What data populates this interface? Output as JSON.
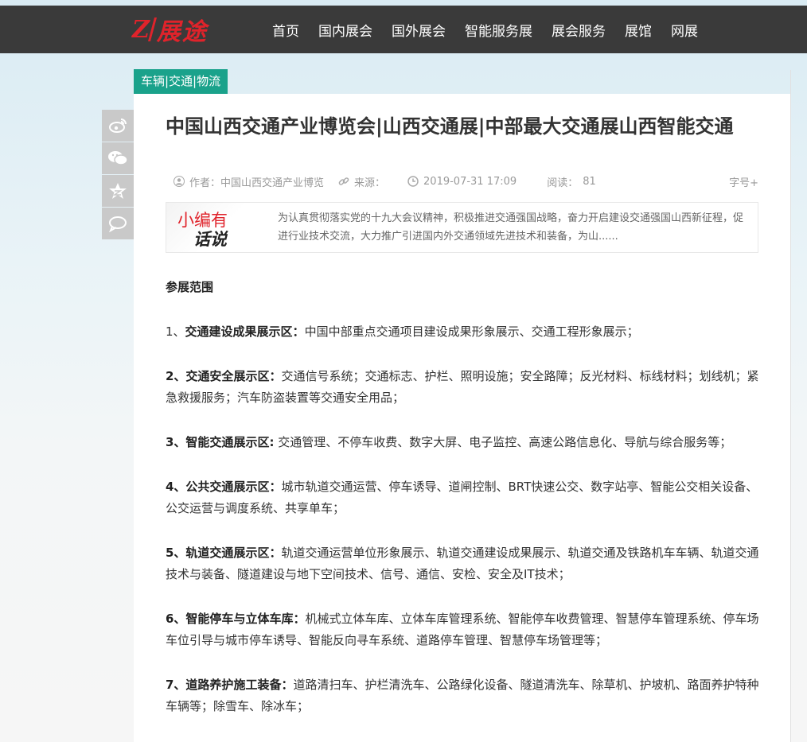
{
  "header": {
    "logo_mark": "Z",
    "logo_name": "展途",
    "nav": [
      "首页",
      "国内展会",
      "国外展会",
      "智能服务展",
      "展会服务",
      "展馆",
      "网展"
    ]
  },
  "category": "车辆|交通|物流",
  "share": [
    "weibo-icon",
    "wechat-icon",
    "qzone-icon",
    "comment-icon"
  ],
  "article": {
    "title": "中国山西交通产业博览会|山西交通展|中部最大交通展山西智能交通",
    "meta": {
      "author_label": "作者：中国山西交通产业博览",
      "source_label": "来源：",
      "datetime": "2019-07-31 17:09",
      "views_label": "阅读：",
      "views": "81",
      "font_size": "字号+"
    },
    "summary": {
      "tag_line1": "小编有",
      "tag_line2": "话说",
      "text": "为认真贯彻落实党的十九大会议精神，积极推进交通强国战略，奋力开启建设交通强国山西新征程，促进行业技术交流，大力推广引进国内外交通领域先进技术和装备，为山......"
    },
    "section_title": "参展范围",
    "items": [
      {
        "heading": "1、交通建设成果展示区：",
        "heading_plain": "1、",
        "heading_bold": "交通建设成果展示区：",
        "text": "中国中部重点交通项目建设成果形象展示、交通工程形象展示；"
      },
      {
        "heading_plain": "",
        "heading_bold": "2、交通安全展示区：",
        "text": "交通信号系统；交通标志、护栏、照明设施；安全路障；反光材料、标线材料；划线机；紧急救援服务；汽车防盗装置等交通安全用品；"
      },
      {
        "heading_plain": "",
        "heading_bold": "3、智能交通展示区:",
        "text": " 交通管理、不停车收费、数字大屏、电子监控、高速公路信息化、导航与综合服务等；"
      },
      {
        "heading_plain": "",
        "heading_bold": "4、公共交通展示区：",
        "text": "城市轨道交通运营、停车诱导、道闸控制、BRT快速公交、数字站亭、智能公交相关设备、公交运营与调度系统、共享单车；"
      },
      {
        "heading_plain": "",
        "heading_bold": "5、轨道交通展示区：",
        "text": "轨道交通运营单位形象展示、轨道交通建设成果展示、轨道交通及铁路机车车辆、轨道交通技术与装备、隧道建设与地下空间技术、信号、通信、安检、安全及IT技术；"
      },
      {
        "heading_plain": "",
        "heading_bold": "6、智能停车与立体车库：",
        "text": "机械式立体车库、立体车库管理系统、智能停车收费管理、智慧停车管理系统、停车场车位引导与城市停车诱导、智能反向寻车系统、道路停车管理、智慧停车场管理等；"
      },
      {
        "heading_plain": "",
        "heading_bold": "7、道路养护施工装备：",
        "text": "道路清扫车、护栏清洗车、公路绿化设备、隧道清洗车、除草机、护坡机、路面养护特种车辆等；除雪车、除冰车；"
      }
    ]
  }
}
